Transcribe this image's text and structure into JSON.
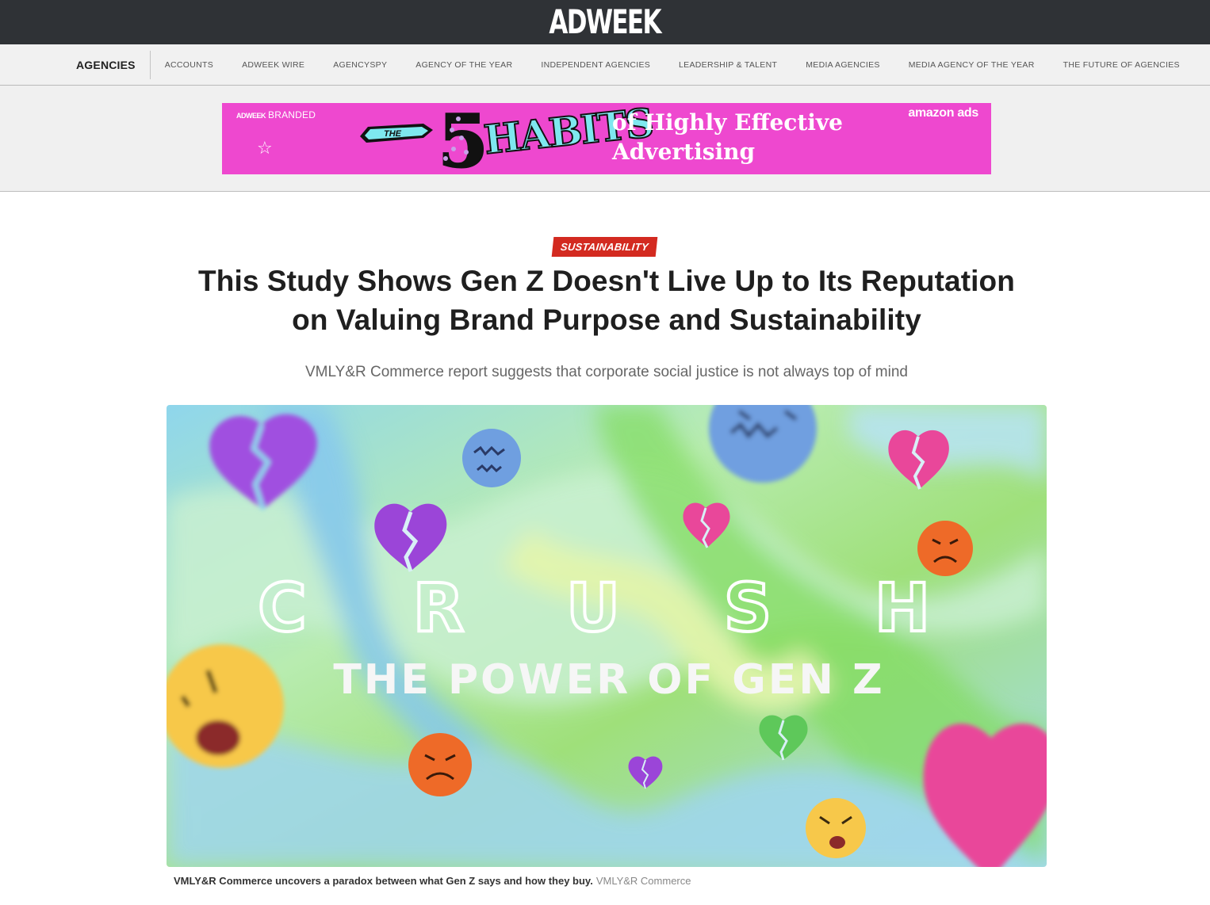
{
  "brand": {
    "logo": "ADWEEK"
  },
  "subnav": {
    "section": "AGENCIES",
    "links": [
      "ACCOUNTS",
      "ADWEEK WIRE",
      "AGENCYSPY",
      "AGENCY OF THE YEAR",
      "INDEPENDENT AGENCIES",
      "LEADERSHIP & TALENT",
      "MEDIA AGENCIES",
      "MEDIA AGENCY OF THE YEAR",
      "THE FUTURE OF AGENCIES"
    ]
  },
  "ad": {
    "branded_logo": "ADWEEK",
    "branded_label": "BRANDED",
    "arrow_text": "THE",
    "number": "5",
    "habits": "HABITS",
    "tagline_line1": "of Highly Effective",
    "tagline_line2": "Advertising",
    "sponsor": "amazon ads",
    "background": "#ee48cf"
  },
  "article": {
    "category": "SUSTAINABILITY",
    "headline_line1": "This Study Shows Gen Z Doesn't Live Up to Its Reputation",
    "headline_line2": "on Valuing Brand Purpose and Sustainability",
    "dek": "VMLY&R Commerce report suggests that corporate social justice is not always top of mind",
    "hero": {
      "letters": [
        "C",
        "R",
        "U",
        "S",
        "H"
      ],
      "subtitle": "THE POWER OF GEN Z"
    },
    "caption": "VMLY&R Commerce uncovers a paradox between what Gen Z says and how they buy.",
    "credit": "VMLY&R Commerce"
  },
  "colors": {
    "topbar": "#2f3236",
    "category_tag": "#d32a20",
    "ad_background": "#ee48cf"
  }
}
